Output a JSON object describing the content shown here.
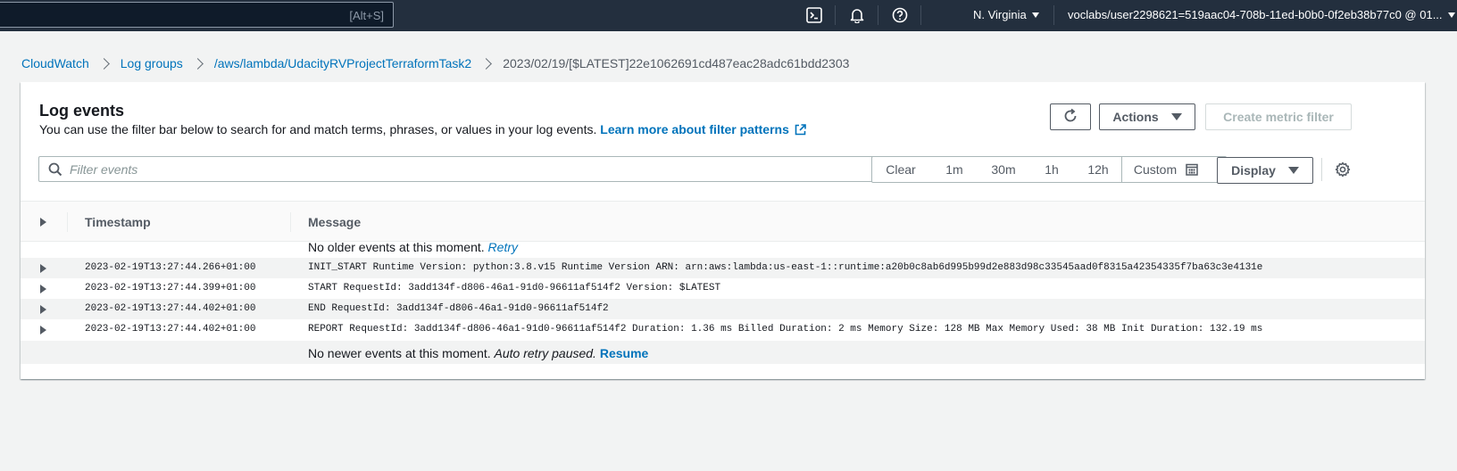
{
  "topnav": {
    "search_shortcut": "[Alt+S]",
    "icons": [
      "cloudshell-icon",
      "notifications-bell-icon",
      "help-icon"
    ],
    "region": "N. Virginia",
    "account": "voclabs/user2298621=519aac04-708b-11ed-b0b0-0f2eb38b77c0 @ 01..."
  },
  "breadcrumb": {
    "items": [
      "CloudWatch",
      "Log groups",
      "/aws/lambda/UdacityRVProjectTerraformTask2"
    ],
    "current": "2023/02/19/[$LATEST]22e1062691cd487eac28adc61bdd2303"
  },
  "panel": {
    "title": "Log events",
    "description": "You can use the filter bar below to search for and match terms, phrases, or values in your log events.",
    "learn_more": "Learn more about filter patterns",
    "actions_label": "Actions",
    "create_metric_label": "Create metric filter",
    "filter_placeholder": "Filter events",
    "ranges": [
      "Clear",
      "1m",
      "30m",
      "1h",
      "12h",
      "Custom"
    ],
    "display_label": "Display"
  },
  "table": {
    "headers": {
      "timestamp": "Timestamp",
      "message": "Message"
    },
    "no_older": {
      "text": "No older events at this moment.",
      "link": "Retry"
    },
    "rows": [
      {
        "timestamp": "2023-02-19T13:27:44.266+01:00",
        "message": "INIT_START Runtime Version: python:3.8.v15 Runtime Version ARN: arn:aws:lambda:us-east-1::runtime:a20b0c8ab6d995b99d2e883d98c33545aad0f8315a42354335f7ba63c3e4131e"
      },
      {
        "timestamp": "2023-02-19T13:27:44.399+01:00",
        "message": "START RequestId: 3add134f-d806-46a1-91d0-96611af514f2 Version: $LATEST"
      },
      {
        "timestamp": "2023-02-19T13:27:44.402+01:00",
        "message": "END RequestId: 3add134f-d806-46a1-91d0-96611af514f2"
      },
      {
        "timestamp": "2023-02-19T13:27:44.402+01:00",
        "message": "REPORT RequestId: 3add134f-d806-46a1-91d0-96611af514f2 Duration: 1.36 ms Billed Duration: 2 ms Memory Size: 128 MB Max Memory Used: 38 MB Init Duration: 132.19 ms"
      }
    ],
    "no_newer": {
      "text": "No newer events at this moment.",
      "status": "Auto retry paused.",
      "link": "Resume"
    }
  },
  "colors": {
    "nav_bg": "#232f3e",
    "link": "#0073bb",
    "page_bg": "#f2f3f3"
  }
}
